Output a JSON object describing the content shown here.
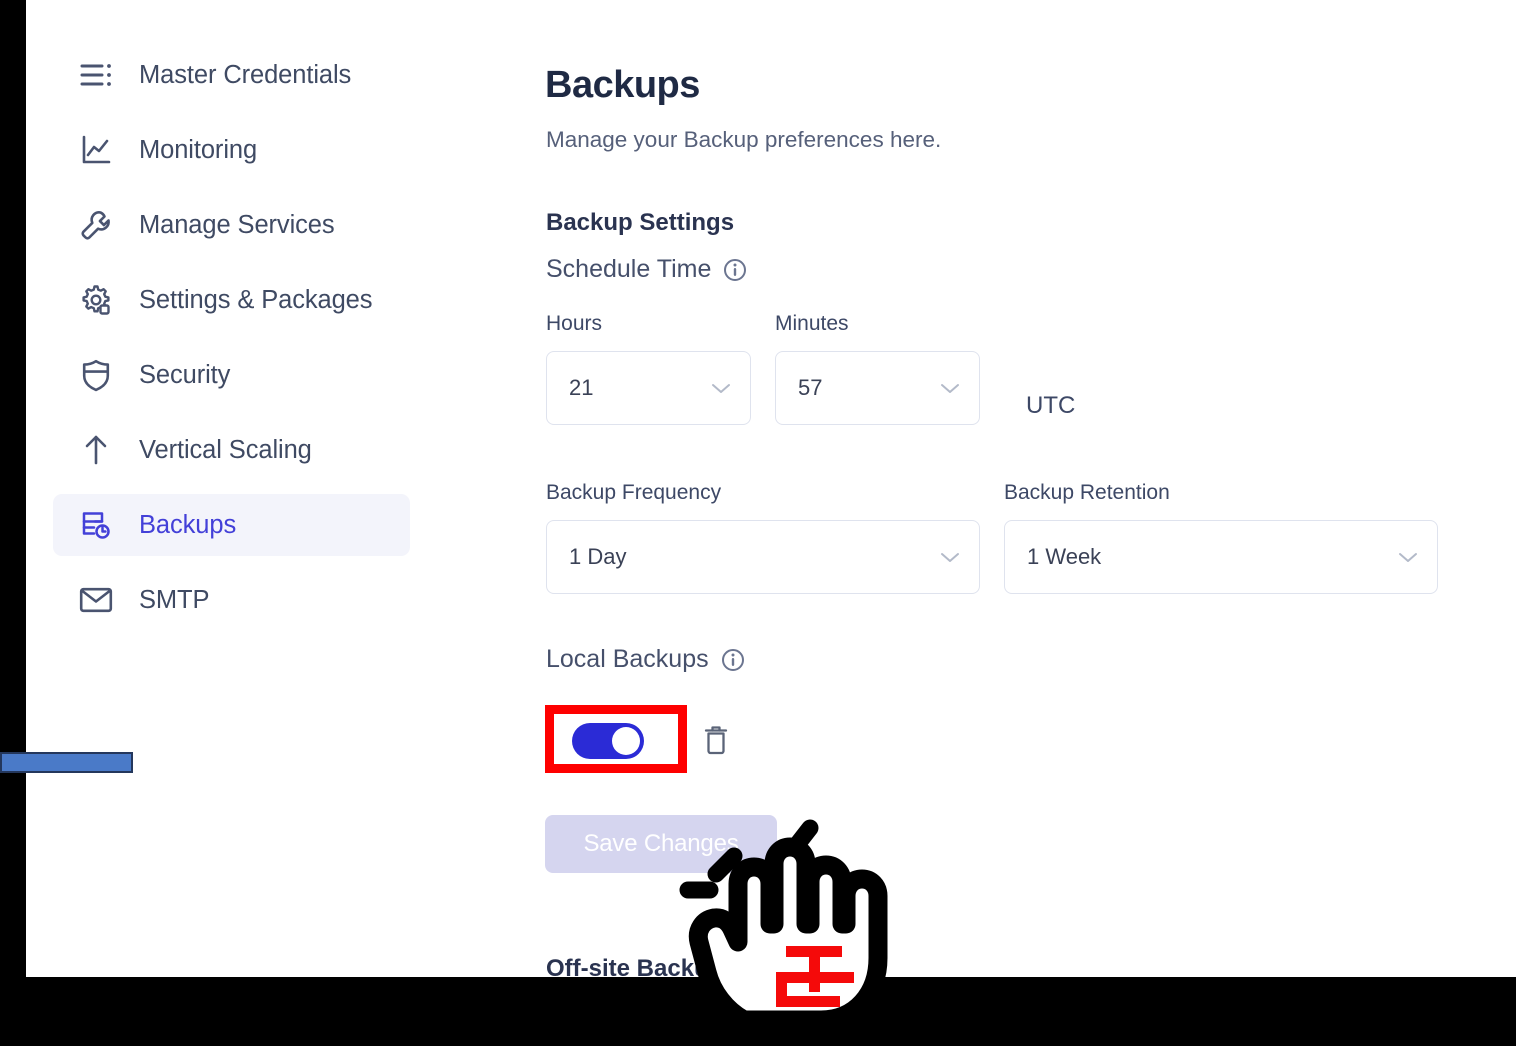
{
  "sidebar": {
    "items": [
      {
        "label": "Master Credentials",
        "icon": "list-icon",
        "active": false
      },
      {
        "label": "Monitoring",
        "icon": "chart-line-icon",
        "active": false
      },
      {
        "label": "Manage Services",
        "icon": "wrench-icon",
        "active": false
      },
      {
        "label": "Settings & Packages",
        "icon": "gear-icon",
        "active": false
      },
      {
        "label": "Security",
        "icon": "shield-icon",
        "active": false
      },
      {
        "label": "Vertical Scaling",
        "icon": "arrow-up-icon",
        "active": false
      },
      {
        "label": "Backups",
        "icon": "backup-database-icon",
        "active": true
      },
      {
        "label": "SMTP",
        "icon": "envelope-icon",
        "active": false
      }
    ]
  },
  "main": {
    "title": "Backups",
    "subtitle": "Manage your Backup preferences here.",
    "section_title": "Backup Settings",
    "schedule_time": {
      "label": "Schedule Time",
      "info_icon": "info-circle-icon",
      "hours": {
        "label": "Hours",
        "value": "21"
      },
      "minutes": {
        "label": "Minutes",
        "value": "57"
      },
      "timezone": "UTC"
    },
    "backup_frequency": {
      "label": "Backup Frequency",
      "value": "1 Day"
    },
    "backup_retention": {
      "label": "Backup Retention",
      "value": "1 Week"
    },
    "local_backups": {
      "label": "Local Backups",
      "info_icon": "info-circle-icon",
      "toggle_state": "on",
      "delete_icon": "trash-icon"
    },
    "save_button": {
      "label": "Save Changes",
      "disabled": true
    },
    "offsite_title": "Off-site Backups"
  },
  "overlay": {
    "highlight_color": "#fe0000",
    "cursor_icon": "pointing-hand-cursor",
    "progress_bar_color": "#4a7ac8"
  },
  "colors": {
    "accent": "#4340d8",
    "toggle_on": "#2b2bd6",
    "active_nav_bg": "#f3f4fb",
    "text_primary": "#2a3350",
    "text_secondary": "#56607a"
  }
}
